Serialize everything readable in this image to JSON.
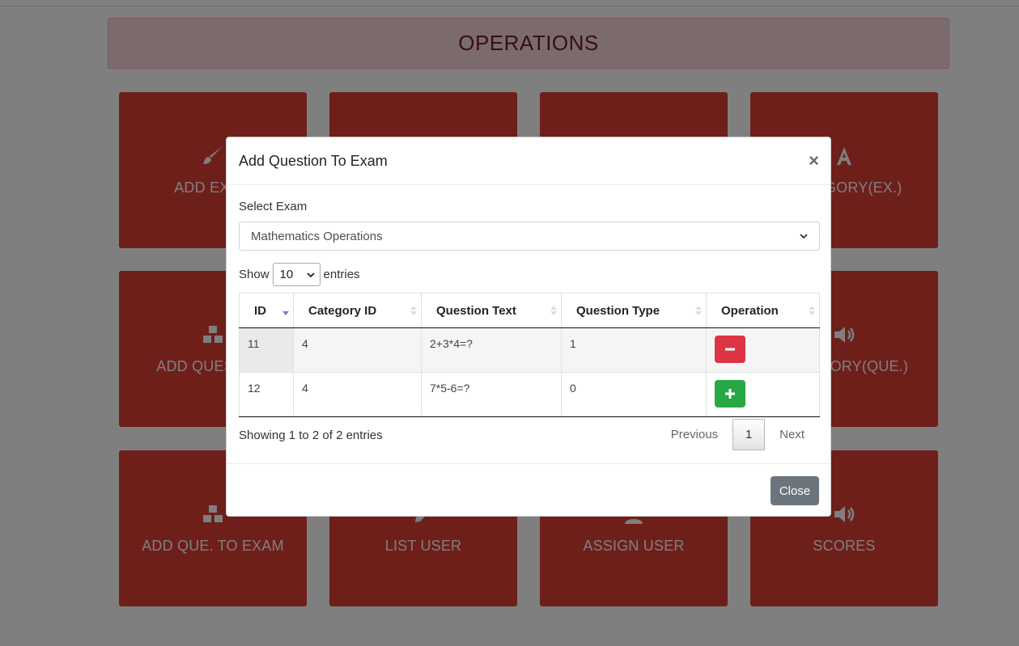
{
  "page": {
    "banner_title": "OPERATIONS",
    "tiles": [
      {
        "label": "ADD EXAM",
        "icon": "paint-brush-icon"
      },
      {
        "label": "",
        "icon": ""
      },
      {
        "label": "",
        "icon": ""
      },
      {
        "label": "CATEGORY(EX.)",
        "icon": "font-icon"
      },
      {
        "label": "ADD QUESTION",
        "icon": "cubes-icon"
      },
      {
        "label": "",
        "icon": ""
      },
      {
        "label": "",
        "icon": ""
      },
      {
        "label": "CATEGORY(QUE.)",
        "icon": "volume-icon"
      },
      {
        "label": "ADD QUE. TO EXAM",
        "icon": "cubes-icon"
      },
      {
        "label": "LIST USER",
        "icon": "pencil-icon"
      },
      {
        "label": "ASSIGN USER",
        "icon": "user-icon"
      },
      {
        "label": "SCORES",
        "icon": "volume-icon"
      }
    ]
  },
  "modal": {
    "title": "Add Question To Exam",
    "close_symbol": "×",
    "select_label": "Select Exam",
    "selected_exam": "Mathematics Operations",
    "show_label": "Show",
    "entries_label": "entries",
    "page_length": "10",
    "columns": [
      "ID",
      "Category ID",
      "Question Text",
      "Question Type",
      "Operation"
    ],
    "rows": [
      {
        "id": "11",
        "category_id": "4",
        "text": "2+3*4=?",
        "type": "1",
        "operation": "remove"
      },
      {
        "id": "12",
        "category_id": "4",
        "text": "7*5-6=?",
        "type": "0",
        "operation": "add"
      }
    ],
    "info": "Showing 1 to 2 of 2 entries",
    "pagination": {
      "previous": "Previous",
      "current": "1",
      "next": "Next"
    },
    "close_button": "Close"
  },
  "colors": {
    "tile": "#dc3f35",
    "banner_bg": "#f8d7da",
    "banner_text": "#721c24",
    "remove_button": "#dc3545",
    "add_button": "#28a745",
    "close_button": "#6c757d"
  }
}
